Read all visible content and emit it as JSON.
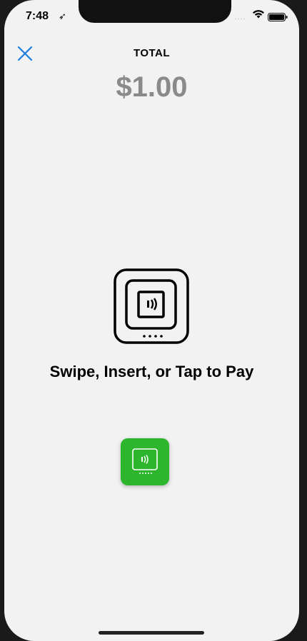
{
  "status_bar": {
    "time": "7:48",
    "location_icon": "location-arrow-icon",
    "signal_dots": "....",
    "wifi_icon": "wifi-icon",
    "battery_icon": "battery-icon"
  },
  "header": {
    "close_icon": "close-icon",
    "title": "TOTAL"
  },
  "amount": "$1.00",
  "reader": {
    "icon": "card-reader-icon",
    "prompt": "Swipe, Insert, or Tap to Pay"
  },
  "tap_button": {
    "icon": "contactless-reader-icon",
    "color": "#2db52d"
  },
  "colors": {
    "accent": "#1a7de0",
    "amount_text": "#8a8a8a",
    "background": "#f2f2f2"
  }
}
